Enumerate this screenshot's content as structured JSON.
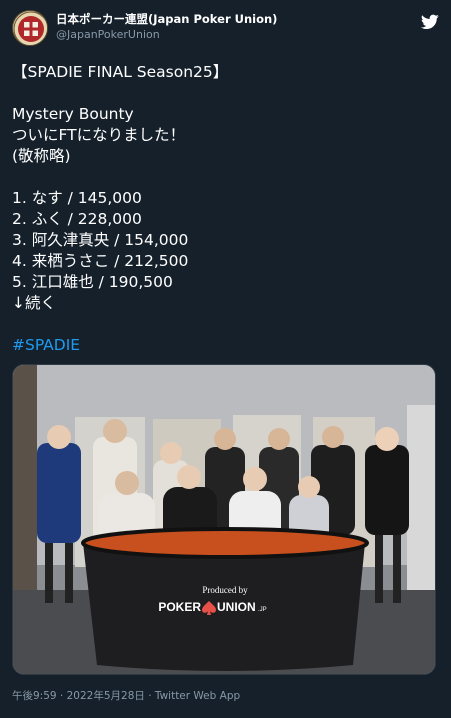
{
  "author": {
    "display_name": "日本ポーカー連盟(Japan Poker Union)",
    "handle": "@JapanPokerUnion"
  },
  "tweet": {
    "lines": [
      "【SPADIE FINAL Season25】",
      "",
      "Mystery Bounty",
      "ついにFTになりました！",
      "(敬称略)",
      "",
      "1. なす / 145,000",
      "2. ふく / 228,000",
      "3. 阿久津真央 / 154,000",
      "4. 来栖うさこ / 212,500",
      "5. 江口雄也 / 190,500",
      "↓続く",
      ""
    ],
    "hashtag": "#SPADIE"
  },
  "photo": {
    "table_sign_line1": "Produced by",
    "table_sign_line2": "POKER",
    "table_sign_line3": "UNION",
    "table_sign_suffix": ".JP"
  },
  "footer": {
    "time": "午後9:59",
    "sep1": " · ",
    "date": "2022年5月28日",
    "sep2": " · ",
    "source": "Twitter Web App"
  },
  "colors": {
    "background": "#15202b",
    "text": "#ffffff",
    "secondary": "#8899a6",
    "link": "#1d9bf0",
    "table_felt": "#c8501e"
  },
  "icons": [
    "avatar-logo-icon",
    "twitter-bird-icon"
  ]
}
